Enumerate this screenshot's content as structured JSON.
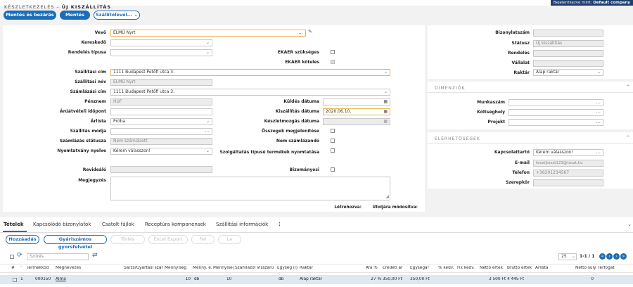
{
  "header": {
    "logged_in": "Bejelentkezve mint:",
    "user": "Default company",
    "breadcrumb_parent": "KÉSZLETKEZELÉS –",
    "breadcrumb_current": "ÚJ KISZÁLLÍTÁS"
  },
  "toolbar": {
    "save_close": "Mentés és bezárás",
    "save": "Mentés",
    "delivery": "Szállítólevél..."
  },
  "form": {
    "vevo_label": "Vevő",
    "vevo_value": "ELMŰ Nyrt",
    "kereskedo_label": "Kereskedő",
    "rendeles_tipusa_label": "Rendelés típusa",
    "ekaer_szukseges_label": "EKAER szükséges",
    "ekaer_koteles_label": "EKAER köteles",
    "szallitasi_cim_label": "Szállítási cím",
    "szallitasi_cim_value": "1111 Budapest Petőfi utca 3.",
    "szallitasi_nev_label": "Szállítási név",
    "szallitasi_nev_value": "ELMŰ Nyrt",
    "szamlazasi_cim_label": "Számlázási cím",
    "szamlazasi_cim_value": "1111 Budapest Petőfi utca 3.",
    "penznem_label": "Pénznem",
    "penznem_value": "HUF",
    "kuldes_datuma_label": "Küldés dátuma",
    "aruatveteli_label": "Árúátvételi időpont",
    "kiszallitas_datuma_label": "Kiszállítás dátuma",
    "kiszallitas_datuma_value": "2020.06.10.",
    "arlista_label": "Árlista",
    "arlista_value": "Próba",
    "keszletmozgas_label": "Készletmozgás dátuma",
    "szallitas_modja_label": "Szállítás módja",
    "osszegek_label": "Összegek megjelenítése",
    "szamlazas_statusza_label": "Számlázás státusza",
    "szamlazas_statusza_value": "Nem számlázott",
    "nem_szamlazando_label": "Nem számlázandó",
    "nyomtatvany_label": "Nyomtatvány nyelve",
    "nyomtatvany_value": "Kérem válasszon!",
    "szolgaltatas_label": "Szolgáltatás típusú termékek nyomtatása",
    "revidealo_label": "Revideáló",
    "bizomanyosi_label": "Bizományosi",
    "megjegyzes_label": "Megjegyzés",
    "letrehozva_label": "Létrehozva:",
    "utoljara_label": "Utoljára módosítva:"
  },
  "right": {
    "bizonylatszam_label": "Bizonylatszám",
    "statusz_label": "Státusz",
    "statusz_value": "Új kiszállítás",
    "rendeles_label": "Rendelés",
    "vallalat_label": "Vállalat",
    "raktar_label": "Raktár",
    "raktar_value": "Alap raktár",
    "dim_title": "DIMENZIÓK",
    "munkaszam_label": "Munkaszám",
    "koltseghely_label": "Költséghely",
    "projekt_label": "Projekt",
    "elerh_title": "ELÉRHETŐSÉGEK",
    "kapcsolattarto_label": "Kapcsolattartó",
    "kapcsolattarto_value": "Kérem válasszon!",
    "email_label": "E-mail",
    "email_value": "tesztjteszt123@teszt.hu",
    "telefon_label": "Telefon",
    "telefon_value": "+36201234567",
    "szerepkor_label": "Szerepkör"
  },
  "tabs": [
    "Tételek",
    "Kapcsolódó bizonylatok",
    "Csatolt fájlok",
    "Receptúra komponensek",
    "Szállítási információk"
  ],
  "grid": {
    "add": "Hozzáadás",
    "serial_add": "Gyáriszámos gyorsfelvétel",
    "delete": "Törlés",
    "excel": "Excel Export",
    "up": "Fel",
    "down": "Le",
    "filter_placeholder": "Szűrés",
    "page_size": "25",
    "pager": "1-1 / 1",
    "headers": [
      "#",
      "Termékkód",
      "Megnevezés",
      "Sarzs/Gyártási szám",
      "Mennyiség",
      "Menny. e.",
      "Mennyiség",
      "Számlázott",
      "Visszárú",
      "Egység (i)",
      "Raktár",
      "Áfa %",
      "Eredeti ár",
      "Egységár",
      "% kedv.",
      "Fix kedv.",
      "Nettó érték",
      "Bruttó érték",
      "Árlista",
      "Nettó súly",
      "Térfogat"
    ],
    "row": {
      "num": "1",
      "code": "000150",
      "name": "Alma",
      "qty": "10",
      "unit": "db",
      "qty2": "10",
      "unit2": "db",
      "warehouse": "Alap raktár",
      "vat": "27 %",
      "orig": "350,00 Ft",
      "unitprice": "350,00 Ft",
      "net": "3 500 Ft",
      "gross": "4 445 Ft",
      "weight": "0"
    }
  }
}
